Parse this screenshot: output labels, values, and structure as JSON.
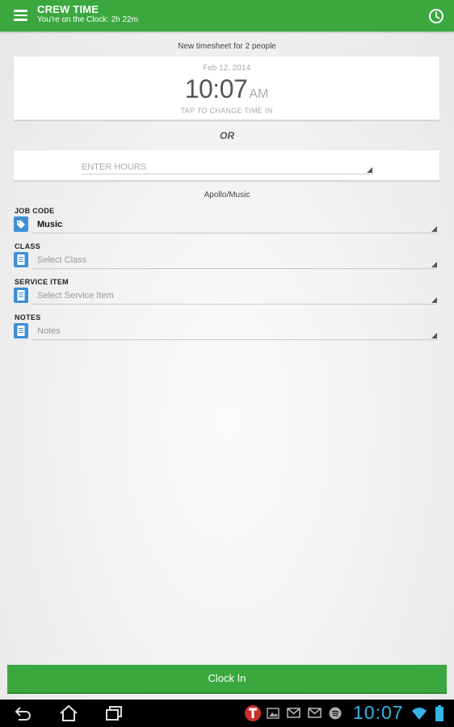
{
  "app": {
    "title": "CREW TIME",
    "subtitle": "You're on the Clock: 2h 22m",
    "accent_color": "#3aa83e"
  },
  "header_icons": [
    "menu-icon",
    "clock-icon"
  ],
  "timesheet": {
    "subtitle": "New timesheet for 2 people",
    "date": "Feb 12, 2014",
    "time_hm": "10:07",
    "time_ampm": "AM",
    "tap_hint": "TAP TO CHANGE TIME IN",
    "or_label": "OR",
    "hours_placeholder": "ENTER HOURS"
  },
  "project": "Apollo/Music",
  "fields": {
    "job_code": {
      "label": "JOB CODE",
      "value": "Music",
      "icon": "tag-icon"
    },
    "class": {
      "label": "CLASS",
      "placeholder": "Select Class",
      "icon": "document-icon"
    },
    "service_item": {
      "label": "SERVICE ITEM",
      "placeholder": "Select Service Item",
      "icon": "document-icon"
    },
    "notes": {
      "label": "NOTES",
      "placeholder": "Notes",
      "icon": "document-icon"
    }
  },
  "actions": {
    "clock_in": "Clock In"
  },
  "system_bar": {
    "time": "10:07",
    "nav_icons": [
      "back-icon",
      "home-icon",
      "recent-apps-icon"
    ],
    "notification_icons": [
      "tsheets-icon",
      "image-icon",
      "gmail-icon",
      "gmail-icon",
      "spotify-icon"
    ],
    "status_icons": [
      "wifi-icon",
      "battery-icon"
    ],
    "clock_color": "#33b5e5"
  }
}
